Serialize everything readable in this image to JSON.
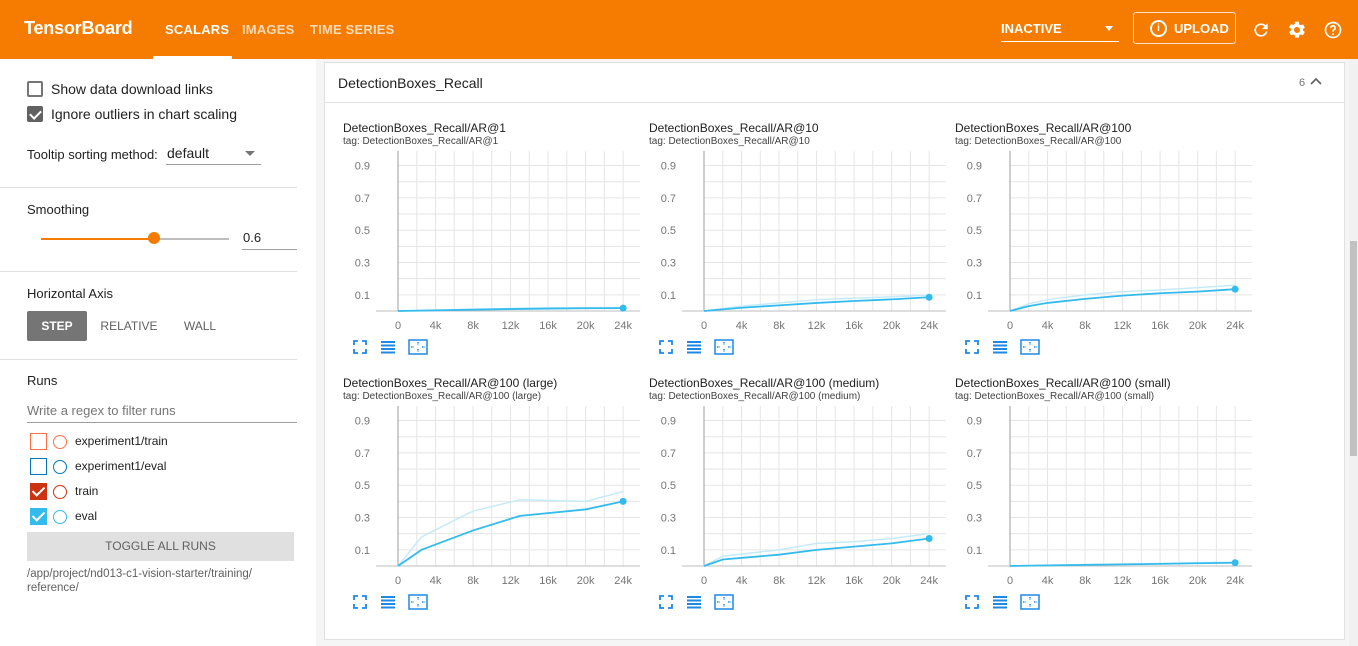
{
  "header": {
    "brand": "TensorBoard",
    "tabs": [
      "SCALARS",
      "IMAGES",
      "TIME SERIES"
    ],
    "active_tab": "SCALARS",
    "status_select": "INACTIVE",
    "upload_label": "UPLOAD",
    "icons": [
      "refresh-icon",
      "settings-icon",
      "help-icon"
    ],
    "colors": {
      "bar": "#f57c00"
    }
  },
  "sidebar": {
    "show_download_links": {
      "label": "Show data download links",
      "checked": false
    },
    "ignore_outliers": {
      "label": "Ignore outliers in chart scaling",
      "checked": true
    },
    "tooltip_sort": {
      "label": "Tooltip sorting method:",
      "value": "default"
    },
    "smoothing": {
      "label": "Smoothing",
      "value": "0.6",
      "fraction": 0.6
    },
    "horizontal_axis": {
      "label": "Horizontal Axis",
      "options": [
        "STEP",
        "RELATIVE",
        "WALL"
      ],
      "selected": "STEP"
    },
    "runs": {
      "label": "Runs",
      "filter_placeholder": "Write a regex to filter runs",
      "items": [
        {
          "name": "experiment1/train",
          "checked": false,
          "color": "#ff7043"
        },
        {
          "name": "experiment1/eval",
          "checked": false,
          "color": "#0077bb"
        },
        {
          "name": "train",
          "checked": true,
          "color": "#cc3311"
        },
        {
          "name": "eval",
          "checked": true,
          "color": "#33bbee"
        }
      ],
      "toggle_label": "TOGGLE ALL RUNS",
      "logdir": "/app/project/nd013-c1-vision-starter/training/\nreference/"
    }
  },
  "main": {
    "group_title": "DetectionBoxes_Recall",
    "group_count": "6"
  },
  "chart_data": [
    {
      "type": "line",
      "title": "DetectionBoxes_Recall/AR@1",
      "tag": "tag: DetectionBoxes_Recall/AR@1",
      "y_ticks": [
        "0.9",
        "0.7",
        "0.5",
        "0.3",
        "0.1"
      ],
      "x_ticks": [
        "0",
        "4k",
        "8k",
        "12k",
        "16k",
        "20k",
        "24k"
      ],
      "series": [
        {
          "x": [
            0,
            4000,
            8000,
            12000,
            16000,
            20000,
            24000
          ],
          "y": [
            0.0,
            0.004,
            0.008,
            0.012,
            0.015,
            0.017,
            0.018
          ]
        },
        {
          "x": [
            0,
            4000,
            8000,
            12000,
            16000,
            20000,
            24000
          ],
          "y": [
            0.0,
            0.006,
            0.011,
            0.016,
            0.019,
            0.021,
            0.022
          ]
        }
      ]
    },
    {
      "type": "line",
      "title": "DetectionBoxes_Recall/AR@10",
      "tag": "tag: DetectionBoxes_Recall/AR@10",
      "y_ticks": [
        "0.9",
        "0.7",
        "0.5",
        "0.3",
        "0.1"
      ],
      "x_ticks": [
        "0",
        "4k",
        "8k",
        "12k",
        "16k",
        "20k",
        "24k"
      ],
      "series": [
        {
          "x": [
            0,
            4000,
            8000,
            12000,
            16000,
            20000,
            24000
          ],
          "y": [
            0.0,
            0.02,
            0.035,
            0.05,
            0.062,
            0.072,
            0.085
          ]
        },
        {
          "x": [
            0,
            4000,
            8000,
            12000,
            16000,
            20000,
            24000
          ],
          "y": [
            0.0,
            0.03,
            0.05,
            0.07,
            0.08,
            0.088,
            0.098
          ]
        }
      ]
    },
    {
      "type": "line",
      "title": "DetectionBoxes_Recall/AR@100",
      "tag": "tag: DetectionBoxes_Recall/AR@100",
      "y_ticks": [
        "0.9",
        "0.7",
        "0.5",
        "0.3",
        "0.1"
      ],
      "x_ticks": [
        "0",
        "4k",
        "8k",
        "12k",
        "16k",
        "20k",
        "24k"
      ],
      "series": [
        {
          "x": [
            0,
            2000,
            4000,
            8000,
            12000,
            16000,
            20000,
            24000
          ],
          "y": [
            0.0,
            0.03,
            0.05,
            0.075,
            0.095,
            0.11,
            0.12,
            0.135
          ]
        },
        {
          "x": [
            0,
            2000,
            4000,
            8000,
            12000,
            16000,
            20000,
            24000
          ],
          "y": [
            0.0,
            0.045,
            0.07,
            0.1,
            0.12,
            0.13,
            0.145,
            0.16
          ]
        }
      ]
    },
    {
      "type": "line",
      "title": "DetectionBoxes_Recall/AR@100 (large)",
      "tag": "tag: DetectionBoxes_Recall/AR@100 (large)",
      "y_ticks": [
        "0.9",
        "0.7",
        "0.5",
        "0.3",
        "0.1"
      ],
      "x_ticks": [
        "0",
        "4k",
        "8k",
        "12k",
        "16k",
        "20k",
        "24k"
      ],
      "series": [
        {
          "x": [
            0,
            2500,
            8000,
            13000,
            20000,
            24000
          ],
          "y": [
            0.0,
            0.1,
            0.22,
            0.31,
            0.35,
            0.4
          ]
        },
        {
          "x": [
            0,
            2500,
            8000,
            13000,
            20000,
            24000
          ],
          "y": [
            0.0,
            0.18,
            0.34,
            0.41,
            0.4,
            0.46
          ]
        }
      ]
    },
    {
      "type": "line",
      "title": "DetectionBoxes_Recall/AR@100 (medium)",
      "tag": "tag: DetectionBoxes_Recall/AR@100 (medium)",
      "y_ticks": [
        "0.9",
        "0.7",
        "0.5",
        "0.3",
        "0.1"
      ],
      "x_ticks": [
        "0",
        "4k",
        "8k",
        "12k",
        "16k",
        "20k",
        "24k"
      ],
      "series": [
        {
          "x": [
            0,
            2000,
            8000,
            12000,
            16000,
            20000,
            24000
          ],
          "y": [
            0.0,
            0.04,
            0.07,
            0.1,
            0.12,
            0.14,
            0.17
          ]
        },
        {
          "x": [
            0,
            2000,
            8000,
            12000,
            16000,
            20000,
            24000
          ],
          "y": [
            0.0,
            0.06,
            0.1,
            0.14,
            0.15,
            0.17,
            0.2
          ]
        }
      ]
    },
    {
      "type": "line",
      "title": "DetectionBoxes_Recall/AR@100 (small)",
      "tag": "tag: DetectionBoxes_Recall/AR@100 (small)",
      "y_ticks": [
        "0.9",
        "0.7",
        "0.5",
        "0.3",
        "0.1"
      ],
      "x_ticks": [
        "0",
        "4k",
        "8k",
        "12k",
        "16k",
        "20k",
        "24k"
      ],
      "series": [
        {
          "x": [
            0,
            4000,
            8000,
            12000,
            16000,
            20000,
            24000
          ],
          "y": [
            0.0,
            0.004,
            0.007,
            0.01,
            0.013,
            0.017,
            0.02
          ]
        },
        {
          "x": [
            0,
            4000,
            8000,
            12000,
            16000,
            20000,
            24000
          ],
          "y": [
            0.0,
            0.005,
            0.009,
            0.012,
            0.016,
            0.02,
            0.024
          ]
        }
      ]
    }
  ]
}
